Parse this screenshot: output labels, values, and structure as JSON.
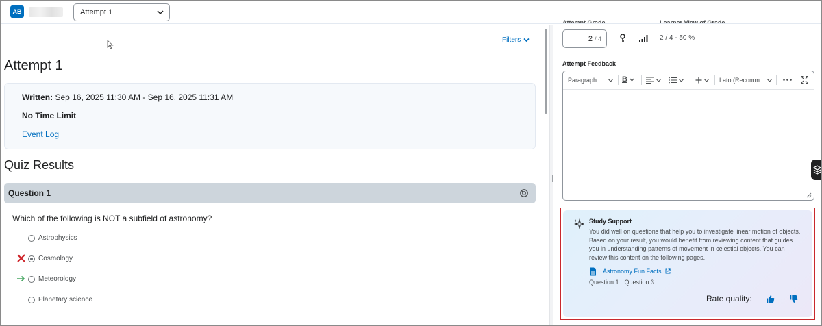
{
  "topbar": {
    "avatar_initials": "AB",
    "attempt_select_value": "Attempt 1"
  },
  "left": {
    "filters_label": "Filters",
    "attempt_title": "Attempt 1",
    "info": {
      "written_label": "Written:",
      "written_value": "Sep 16, 2025 11:30 AM - Sep 16, 2025 11:31 AM",
      "time_limit": "No Time Limit",
      "event_log": "Event Log"
    },
    "quiz_results_title": "Quiz Results",
    "question": {
      "label": "Question 1",
      "text": "Which of the following is NOT a subfield of astronomy?",
      "options": [
        {
          "label": "Astrophysics",
          "selected": false,
          "mark": "none"
        },
        {
          "label": "Cosmology",
          "selected": true,
          "mark": "incorrect"
        },
        {
          "label": "Meteorology",
          "selected": false,
          "mark": "correct-answer"
        },
        {
          "label": "Planetary science",
          "selected": false,
          "mark": "none"
        }
      ]
    }
  },
  "right": {
    "attempt_grade_label": "Attempt Grade",
    "learner_view_label": "Learner View of Grade",
    "grade_value": "2",
    "grade_out_of": "/ 4",
    "learner_grade": "2 / 4 - 50 %",
    "feedback_label": "Attempt Feedback",
    "toolbar": {
      "paragraph": "Paragraph",
      "bold": "B",
      "font": "Lato (Recomm..."
    },
    "study_support": {
      "title": "Study Support",
      "body": "You did well on questions that help you to investigate linear motion of objects. Based on your result, you would benefit from reviewing content that guides you in understanding patterns of movement in celestial objects. You can review this content on the following pages.",
      "resource_title": "Astronomy Fun Facts",
      "resource_questions": [
        "Question 1",
        "Question 3"
      ],
      "rate_label": "Rate quality:"
    }
  },
  "colors": {
    "accent": "#006fbf",
    "incorrect": "#cd2026",
    "correct": "#46a661",
    "highlight_outline": "#c9282d"
  }
}
